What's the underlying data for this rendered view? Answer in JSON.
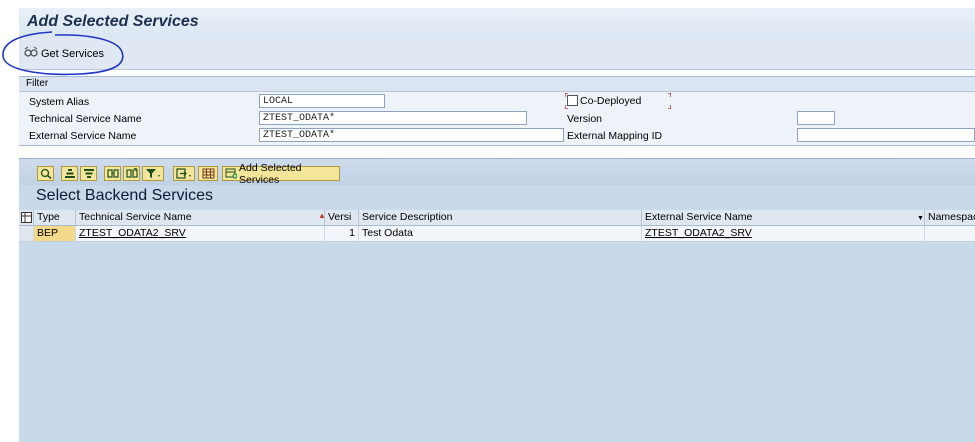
{
  "title": "Add Selected Services",
  "toolbar": {
    "get_services_label": "Get Services"
  },
  "filter": {
    "header": "Filter",
    "system_alias_label": "System Alias",
    "system_alias_value": "LOCAL",
    "technical_service_name_label": "Technical Service Name",
    "technical_service_name_value": "ZTEST_ODATA*",
    "external_service_name_label": "External Service Name",
    "external_service_name_value": "ZTEST_ODATA*",
    "co_deployed_label": "Co-Deployed",
    "co_deployed_checked": false,
    "version_label": "Version",
    "version_value": "",
    "external_mapping_id_label": "External Mapping ID",
    "external_mapping_id_value": ""
  },
  "results": {
    "toolbar_icons": [
      "details-icon",
      "sort-ascending-icon",
      "sort-descending-icon",
      "find-icon",
      "find-next-icon",
      "filter-icon",
      "export-icon",
      "layout-icon"
    ],
    "add_selected_services_label": "Add Selected Services",
    "section_title": "Select Backend Services",
    "columns": [
      "Type",
      "Technical Service Name",
      "Versi",
      "Service Description",
      "External Service Name",
      "Namespace"
    ],
    "rows": [
      {
        "type": "BEP",
        "technical_service_name": "ZTEST_ODATA2_SRV",
        "version": "1",
        "service_description": "Test Odata",
        "external_service_name": "ZTEST_ODATA2_SRV",
        "namespace": ""
      }
    ]
  },
  "colors": {
    "annotation": "#2036c8",
    "row_highlight": "#f4d98a",
    "toolbar_button": "#f3e59a"
  }
}
